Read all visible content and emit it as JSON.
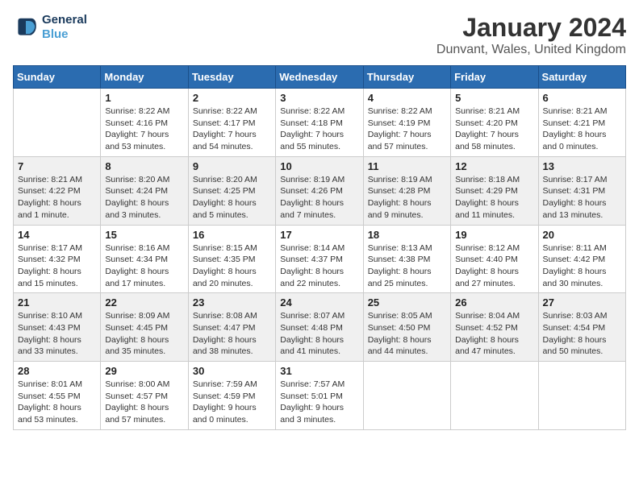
{
  "logo": {
    "text_general": "General",
    "text_blue": "Blue"
  },
  "title": "January 2024",
  "subtitle": "Dunvant, Wales, United Kingdom",
  "days_of_week": [
    "Sunday",
    "Monday",
    "Tuesday",
    "Wednesday",
    "Thursday",
    "Friday",
    "Saturday"
  ],
  "weeks": [
    [
      {
        "day": "",
        "sunrise": "",
        "sunset": "",
        "daylight": ""
      },
      {
        "day": "1",
        "sunrise": "Sunrise: 8:22 AM",
        "sunset": "Sunset: 4:16 PM",
        "daylight": "Daylight: 7 hours and 53 minutes."
      },
      {
        "day": "2",
        "sunrise": "Sunrise: 8:22 AM",
        "sunset": "Sunset: 4:17 PM",
        "daylight": "Daylight: 7 hours and 54 minutes."
      },
      {
        "day": "3",
        "sunrise": "Sunrise: 8:22 AM",
        "sunset": "Sunset: 4:18 PM",
        "daylight": "Daylight: 7 hours and 55 minutes."
      },
      {
        "day": "4",
        "sunrise": "Sunrise: 8:22 AM",
        "sunset": "Sunset: 4:19 PM",
        "daylight": "Daylight: 7 hours and 57 minutes."
      },
      {
        "day": "5",
        "sunrise": "Sunrise: 8:21 AM",
        "sunset": "Sunset: 4:20 PM",
        "daylight": "Daylight: 7 hours and 58 minutes."
      },
      {
        "day": "6",
        "sunrise": "Sunrise: 8:21 AM",
        "sunset": "Sunset: 4:21 PM",
        "daylight": "Daylight: 8 hours and 0 minutes."
      }
    ],
    [
      {
        "day": "7",
        "sunrise": "Sunrise: 8:21 AM",
        "sunset": "Sunset: 4:22 PM",
        "daylight": "Daylight: 8 hours and 1 minute."
      },
      {
        "day": "8",
        "sunrise": "Sunrise: 8:20 AM",
        "sunset": "Sunset: 4:24 PM",
        "daylight": "Daylight: 8 hours and 3 minutes."
      },
      {
        "day": "9",
        "sunrise": "Sunrise: 8:20 AM",
        "sunset": "Sunset: 4:25 PM",
        "daylight": "Daylight: 8 hours and 5 minutes."
      },
      {
        "day": "10",
        "sunrise": "Sunrise: 8:19 AM",
        "sunset": "Sunset: 4:26 PM",
        "daylight": "Daylight: 8 hours and 7 minutes."
      },
      {
        "day": "11",
        "sunrise": "Sunrise: 8:19 AM",
        "sunset": "Sunset: 4:28 PM",
        "daylight": "Daylight: 8 hours and 9 minutes."
      },
      {
        "day": "12",
        "sunrise": "Sunrise: 8:18 AM",
        "sunset": "Sunset: 4:29 PM",
        "daylight": "Daylight: 8 hours and 11 minutes."
      },
      {
        "day": "13",
        "sunrise": "Sunrise: 8:17 AM",
        "sunset": "Sunset: 4:31 PM",
        "daylight": "Daylight: 8 hours and 13 minutes."
      }
    ],
    [
      {
        "day": "14",
        "sunrise": "Sunrise: 8:17 AM",
        "sunset": "Sunset: 4:32 PM",
        "daylight": "Daylight: 8 hours and 15 minutes."
      },
      {
        "day": "15",
        "sunrise": "Sunrise: 8:16 AM",
        "sunset": "Sunset: 4:34 PM",
        "daylight": "Daylight: 8 hours and 17 minutes."
      },
      {
        "day": "16",
        "sunrise": "Sunrise: 8:15 AM",
        "sunset": "Sunset: 4:35 PM",
        "daylight": "Daylight: 8 hours and 20 minutes."
      },
      {
        "day": "17",
        "sunrise": "Sunrise: 8:14 AM",
        "sunset": "Sunset: 4:37 PM",
        "daylight": "Daylight: 8 hours and 22 minutes."
      },
      {
        "day": "18",
        "sunrise": "Sunrise: 8:13 AM",
        "sunset": "Sunset: 4:38 PM",
        "daylight": "Daylight: 8 hours and 25 minutes."
      },
      {
        "day": "19",
        "sunrise": "Sunrise: 8:12 AM",
        "sunset": "Sunset: 4:40 PM",
        "daylight": "Daylight: 8 hours and 27 minutes."
      },
      {
        "day": "20",
        "sunrise": "Sunrise: 8:11 AM",
        "sunset": "Sunset: 4:42 PM",
        "daylight": "Daylight: 8 hours and 30 minutes."
      }
    ],
    [
      {
        "day": "21",
        "sunrise": "Sunrise: 8:10 AM",
        "sunset": "Sunset: 4:43 PM",
        "daylight": "Daylight: 8 hours and 33 minutes."
      },
      {
        "day": "22",
        "sunrise": "Sunrise: 8:09 AM",
        "sunset": "Sunset: 4:45 PM",
        "daylight": "Daylight: 8 hours and 35 minutes."
      },
      {
        "day": "23",
        "sunrise": "Sunrise: 8:08 AM",
        "sunset": "Sunset: 4:47 PM",
        "daylight": "Daylight: 8 hours and 38 minutes."
      },
      {
        "day": "24",
        "sunrise": "Sunrise: 8:07 AM",
        "sunset": "Sunset: 4:48 PM",
        "daylight": "Daylight: 8 hours and 41 minutes."
      },
      {
        "day": "25",
        "sunrise": "Sunrise: 8:05 AM",
        "sunset": "Sunset: 4:50 PM",
        "daylight": "Daylight: 8 hours and 44 minutes."
      },
      {
        "day": "26",
        "sunrise": "Sunrise: 8:04 AM",
        "sunset": "Sunset: 4:52 PM",
        "daylight": "Daylight: 8 hours and 47 minutes."
      },
      {
        "day": "27",
        "sunrise": "Sunrise: 8:03 AM",
        "sunset": "Sunset: 4:54 PM",
        "daylight": "Daylight: 8 hours and 50 minutes."
      }
    ],
    [
      {
        "day": "28",
        "sunrise": "Sunrise: 8:01 AM",
        "sunset": "Sunset: 4:55 PM",
        "daylight": "Daylight: 8 hours and 53 minutes."
      },
      {
        "day": "29",
        "sunrise": "Sunrise: 8:00 AM",
        "sunset": "Sunset: 4:57 PM",
        "daylight": "Daylight: 8 hours and 57 minutes."
      },
      {
        "day": "30",
        "sunrise": "Sunrise: 7:59 AM",
        "sunset": "Sunset: 4:59 PM",
        "daylight": "Daylight: 9 hours and 0 minutes."
      },
      {
        "day": "31",
        "sunrise": "Sunrise: 7:57 AM",
        "sunset": "Sunset: 5:01 PM",
        "daylight": "Daylight: 9 hours and 3 minutes."
      },
      {
        "day": "",
        "sunrise": "",
        "sunset": "",
        "daylight": ""
      },
      {
        "day": "",
        "sunrise": "",
        "sunset": "",
        "daylight": ""
      },
      {
        "day": "",
        "sunrise": "",
        "sunset": "",
        "daylight": ""
      }
    ]
  ]
}
